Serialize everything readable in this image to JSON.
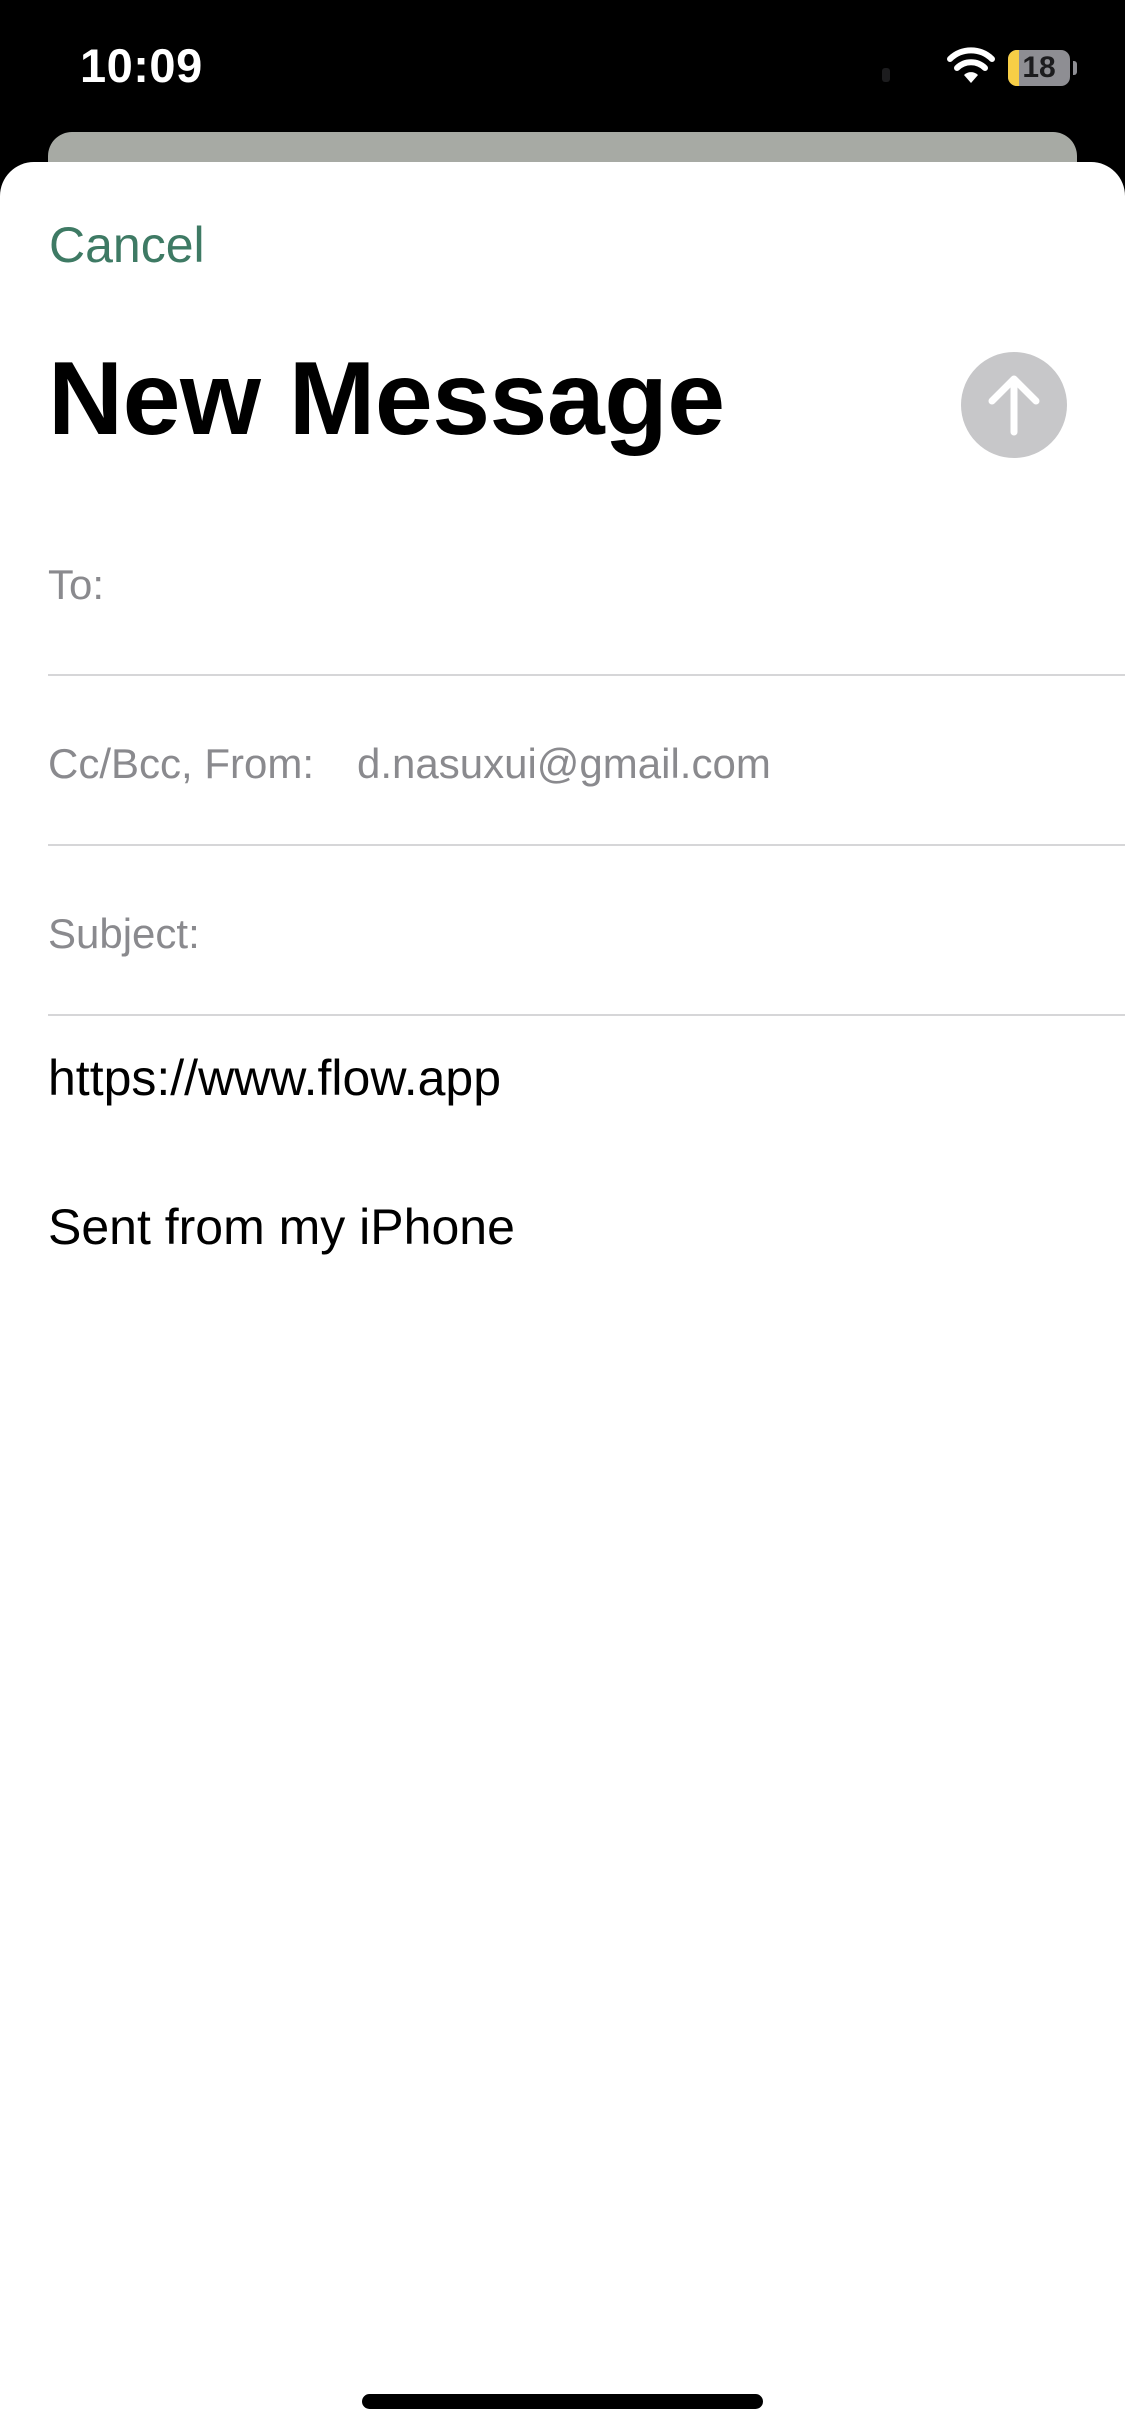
{
  "status_bar": {
    "time": "10:09",
    "battery_level": "18",
    "battery_fraction": 0.18,
    "battery_color": "#f7ce46",
    "icons": [
      "wifi-icon",
      "battery-icon"
    ]
  },
  "compose": {
    "cancel_label": "Cancel",
    "title": "New Message",
    "send_icon": "arrow-up-icon",
    "accent_color": "#3e7a64"
  },
  "fields": {
    "to_label": "To:",
    "to_value": "",
    "ccbcc_label": "Cc/Bcc, From:",
    "from_value": "d.nasuxui@gmail.com",
    "subject_label": "Subject:",
    "subject_value": ""
  },
  "body": {
    "link": "https://www.flow.app",
    "signature": "Sent from my iPhone"
  }
}
